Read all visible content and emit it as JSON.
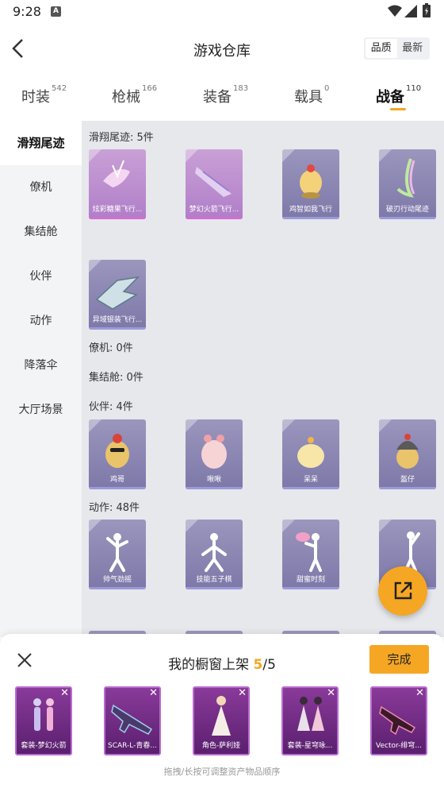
{
  "status_bar": {
    "time": "9:28",
    "notification_icon": "A"
  },
  "header": {
    "title": "游戏仓库",
    "back_icon": "chevron-left-icon",
    "sort_options": [
      "品质",
      "最新"
    ]
  },
  "categories": [
    {
      "label": "时装",
      "count": "542"
    },
    {
      "label": "枪械",
      "count": "166"
    },
    {
      "label": "装备",
      "count": "183"
    },
    {
      "label": "载具",
      "count": "0"
    },
    {
      "label": "战备",
      "count": "110"
    }
  ],
  "sidenav": [
    "滑翔尾迹",
    "僚机",
    "集结舱",
    "伙伴",
    "动作",
    "降落伞",
    "大厅场景"
  ],
  "sections": {
    "trail": {
      "label": "滑翔尾迹: 5件",
      "items": [
        "炫彩糖果飞行...",
        "梦幻火箭飞行...",
        "鸡智如我飞行",
        "破刃行动尾迹",
        "异域银装飞行..."
      ]
    },
    "wingman": {
      "label": "僚机: 0件"
    },
    "pod": {
      "label": "集结舱: 0件"
    },
    "companion": {
      "label": "伙伴: 4件",
      "items": [
        "鸡哥",
        "啾啾",
        "呆呆",
        "盔仔"
      ]
    },
    "emote": {
      "label": "动作: 48件",
      "items": [
        "帅气劲摇",
        "技能五子棋",
        "甜蜜时刻"
      ]
    }
  },
  "showcase": {
    "title_prefix": "我的橱窗上架 ",
    "current": "5",
    "total": "/5",
    "done_label": "完成",
    "items": [
      "套装-梦幻火箭",
      "SCAR-L-青春...",
      "角色-萨利娅",
      "套装-星穹咏...",
      "Vector-绯穹..."
    ],
    "hint": "拖拽/长按可调整资产物品顺序"
  },
  "colors": {
    "accent": "#f5a623",
    "rare_pink": "#d16fd0",
    "epic_purple": "#9b9bd8",
    "showcase_bg": "#5a1f6e"
  }
}
